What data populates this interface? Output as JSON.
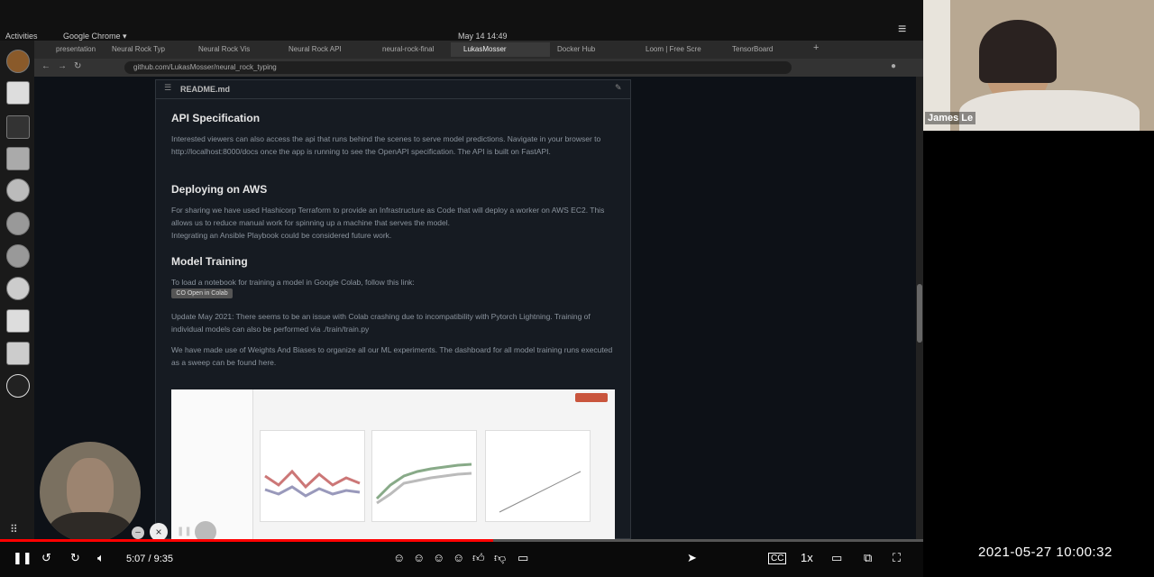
{
  "topbar": {
    "activities": "Activities",
    "app": "Google Chrome ▾",
    "clock": "May 14  14:49"
  },
  "tabs": [
    {
      "label": "presentation",
      "active": false
    },
    {
      "label": "Neural Rock Typ",
      "active": false
    },
    {
      "label": "Neural Rock Vis",
      "active": false
    },
    {
      "label": "Neural Rock API",
      "active": false
    },
    {
      "label": "neural-rock-final",
      "active": false
    },
    {
      "label": "LukasMosser",
      "active": true
    },
    {
      "label": "Docker Hub",
      "active": false
    },
    {
      "label": "Loom | Free Scre",
      "active": false
    },
    {
      "label": "TensorBoard",
      "active": false
    }
  ],
  "url": "github.com/LukasMosser/neural_rock_typing",
  "readme": {
    "header": "README.md",
    "sections": [
      {
        "title": "API Specification",
        "paragraphs": [
          "Interested viewers can also access the api that runs behind the scenes to serve model predictions. Navigate in your browser to http://localhost:8000/docs once the app is running to see the OpenAPI specification. The API is built on FastAPI."
        ]
      },
      {
        "title": "Deploying on AWS",
        "paragraphs": [
          "For sharing we have used Hashicorp Terraform to provide an Infrastructure as Code that will deploy a worker on AWS EC2. This allows us to reduce manual work for spinning up a machine that serves the model.",
          "Integrating an Ansible Playbook could be considered future work."
        ]
      },
      {
        "title": "Model Training",
        "paragraphs": [
          "To load a notebook for training a model in Google Colab, follow this link:",
          "Update May 2021: There seems to be an issue with Colab crashing due to incompatibility with Pytorch Lightning. Training of individual models can also be performed via ./train/train.py",
          "We have made use of Weights And Biases to organize all our ML experiments. The dashboard for all model training runs executed as a sweep can be found here."
        ]
      }
    ],
    "colab_badge": "CO  Open in Colab"
  },
  "webcam": {
    "name": "James Le"
  },
  "player": {
    "current_time": "5:07",
    "duration": "9:35",
    "time_display": "5:07 / 9:35",
    "progress": 0.534,
    "speed": "1x",
    "cc": "CC"
  },
  "timestamp": "2021-05-27 10:00:32",
  "colors": {
    "progress": "#ff0000",
    "page_bg": "#0d1117"
  }
}
